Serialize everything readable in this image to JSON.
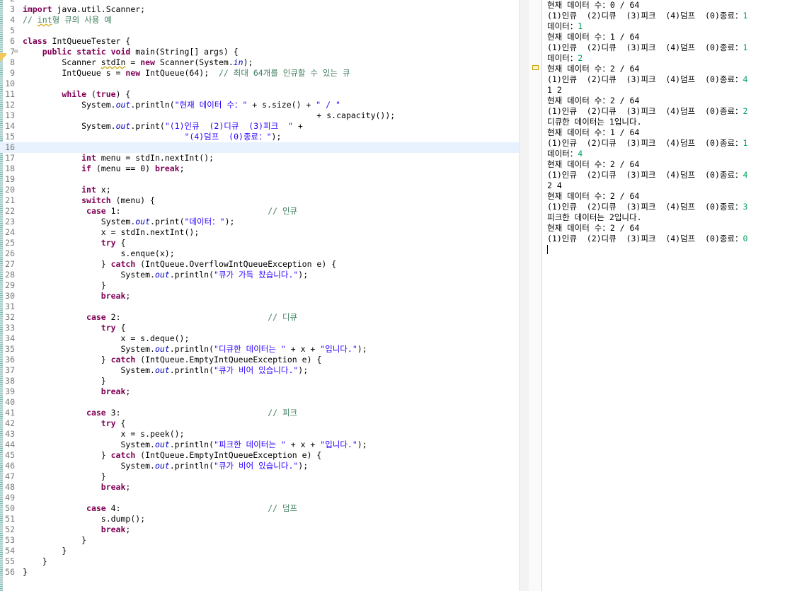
{
  "editor": {
    "lines": [
      {
        "n": "2",
        "t": []
      },
      {
        "n": "3",
        "t": [
          {
            "k": "kw",
            "v": "import"
          },
          {
            "k": "",
            "v": " java.util.Scanner;"
          }
        ]
      },
      {
        "n": "4",
        "t": [
          {
            "k": "cm",
            "v": "// "
          },
          {
            "k": "cm sq",
            "v": "int"
          },
          {
            "k": "cm",
            "v": "형 큐의 사용 예"
          }
        ]
      },
      {
        "n": "5",
        "t": []
      },
      {
        "n": "6",
        "t": [
          {
            "k": "kw",
            "v": "class"
          },
          {
            "k": "",
            "v": " IntQueueTester {"
          }
        ]
      },
      {
        "n": "7",
        "fold": "⊖",
        "t": [
          {
            "k": "",
            "v": "    "
          },
          {
            "k": "kw",
            "v": "public static void"
          },
          {
            "k": "",
            "v": " main(String[] args) {"
          }
        ]
      },
      {
        "n": "8",
        "t": [
          {
            "k": "",
            "v": "        Scanner "
          },
          {
            "k": "sq",
            "v": "stdIn"
          },
          {
            "k": "",
            "v": " = "
          },
          {
            "k": "kw",
            "v": "new"
          },
          {
            "k": "",
            "v": " Scanner(System."
          },
          {
            "k": "fld",
            "v": "in"
          },
          {
            "k": "",
            "v": ");"
          }
        ]
      },
      {
        "n": "9",
        "t": [
          {
            "k": "",
            "v": "        IntQueue s = "
          },
          {
            "k": "kw",
            "v": "new"
          },
          {
            "k": "",
            "v": " IntQueue(64);  "
          },
          {
            "k": "cm",
            "v": "// 최대 64개를 인큐할 수 있는 큐"
          }
        ]
      },
      {
        "n": "10",
        "t": []
      },
      {
        "n": "11",
        "t": [
          {
            "k": "",
            "v": "        "
          },
          {
            "k": "kw",
            "v": "while"
          },
          {
            "k": "",
            "v": " ("
          },
          {
            "k": "kw",
            "v": "true"
          },
          {
            "k": "",
            "v": ") {"
          }
        ]
      },
      {
        "n": "12",
        "t": [
          {
            "k": "",
            "v": "            System."
          },
          {
            "k": "fld",
            "v": "out"
          },
          {
            "k": "",
            "v": ".println("
          },
          {
            "k": "str",
            "v": "\"현재 데이터 수：\""
          },
          {
            "k": "",
            "v": " + s.size() + "
          },
          {
            "k": "str",
            "v": "\" / \""
          }
        ]
      },
      {
        "n": "13",
        "t": [
          {
            "k": "",
            "v": "                                                            + s.capacity());"
          }
        ]
      },
      {
        "n": "14",
        "t": [
          {
            "k": "",
            "v": "            System."
          },
          {
            "k": "fld",
            "v": "out"
          },
          {
            "k": "",
            "v": ".print("
          },
          {
            "k": "str",
            "v": "\"(1)인큐  (2)디큐  (3)피크  \""
          },
          {
            "k": "",
            "v": " +"
          }
        ]
      },
      {
        "n": "15",
        "t": [
          {
            "k": "",
            "v": "                                 "
          },
          {
            "k": "str",
            "v": "\"(4)덤프  (0)종료：\""
          },
          {
            "k": "",
            "v": ");"
          }
        ]
      },
      {
        "n": "16",
        "current": true,
        "t": []
      },
      {
        "n": "17",
        "t": [
          {
            "k": "",
            "v": "            "
          },
          {
            "k": "kw",
            "v": "int"
          },
          {
            "k": "",
            "v": " menu = stdIn.nextInt();"
          }
        ]
      },
      {
        "n": "18",
        "t": [
          {
            "k": "",
            "v": "            "
          },
          {
            "k": "kw",
            "v": "if"
          },
          {
            "k": "",
            "v": " (menu == 0) "
          },
          {
            "k": "kw",
            "v": "break"
          },
          {
            "k": "",
            "v": ";"
          }
        ]
      },
      {
        "n": "19",
        "t": []
      },
      {
        "n": "20",
        "t": [
          {
            "k": "",
            "v": "            "
          },
          {
            "k": "kw",
            "v": "int"
          },
          {
            "k": "",
            "v": " x;"
          }
        ]
      },
      {
        "n": "21",
        "t": [
          {
            "k": "",
            "v": "            "
          },
          {
            "k": "kw",
            "v": "switch"
          },
          {
            "k": "",
            "v": " (menu) {"
          }
        ]
      },
      {
        "n": "22",
        "t": [
          {
            "k": "",
            "v": "             "
          },
          {
            "k": "kw",
            "v": "case"
          },
          {
            "k": "",
            "v": " 1:                              "
          },
          {
            "k": "cm",
            "v": "// 인큐"
          }
        ]
      },
      {
        "n": "23",
        "t": [
          {
            "k": "",
            "v": "                System."
          },
          {
            "k": "fld",
            "v": "out"
          },
          {
            "k": "",
            "v": ".print("
          },
          {
            "k": "str",
            "v": "\"데이터：\""
          },
          {
            "k": "",
            "v": ");"
          }
        ]
      },
      {
        "n": "24",
        "t": [
          {
            "k": "",
            "v": "                x = stdIn.nextInt();"
          }
        ]
      },
      {
        "n": "25",
        "t": [
          {
            "k": "",
            "v": "                "
          },
          {
            "k": "kw",
            "v": "try"
          },
          {
            "k": "",
            "v": " {"
          }
        ]
      },
      {
        "n": "26",
        "t": [
          {
            "k": "",
            "v": "                    s.enque(x);"
          }
        ]
      },
      {
        "n": "27",
        "t": [
          {
            "k": "",
            "v": "                } "
          },
          {
            "k": "kw",
            "v": "catch"
          },
          {
            "k": "",
            "v": " (IntQueue.OverflowIntQueueException e) {"
          }
        ]
      },
      {
        "n": "28",
        "t": [
          {
            "k": "",
            "v": "                    System."
          },
          {
            "k": "fld",
            "v": "out"
          },
          {
            "k": "",
            "v": ".println("
          },
          {
            "k": "str",
            "v": "\"큐가 가득 찼습니다.\""
          },
          {
            "k": "",
            "v": ");"
          }
        ]
      },
      {
        "n": "29",
        "t": [
          {
            "k": "",
            "v": "                }"
          }
        ]
      },
      {
        "n": "30",
        "t": [
          {
            "k": "",
            "v": "                "
          },
          {
            "k": "kw",
            "v": "break"
          },
          {
            "k": "",
            "v": ";"
          }
        ]
      },
      {
        "n": "31",
        "t": []
      },
      {
        "n": "32",
        "t": [
          {
            "k": "",
            "v": "             "
          },
          {
            "k": "kw",
            "v": "case"
          },
          {
            "k": "",
            "v": " 2:                              "
          },
          {
            "k": "cm",
            "v": "// 디큐"
          }
        ]
      },
      {
        "n": "33",
        "t": [
          {
            "k": "",
            "v": "                "
          },
          {
            "k": "kw",
            "v": "try"
          },
          {
            "k": "",
            "v": " {"
          }
        ]
      },
      {
        "n": "34",
        "t": [
          {
            "k": "",
            "v": "                    x = s.deque();"
          }
        ]
      },
      {
        "n": "35",
        "t": [
          {
            "k": "",
            "v": "                    System."
          },
          {
            "k": "fld",
            "v": "out"
          },
          {
            "k": "",
            "v": ".println("
          },
          {
            "k": "str",
            "v": "\"디큐한 데이터는 \""
          },
          {
            "k": "",
            "v": " + x + "
          },
          {
            "k": "str",
            "v": "\"입니다.\""
          },
          {
            "k": "",
            "v": ");"
          }
        ]
      },
      {
        "n": "36",
        "t": [
          {
            "k": "",
            "v": "                } "
          },
          {
            "k": "kw",
            "v": "catch"
          },
          {
            "k": "",
            "v": " (IntQueue.EmptyIntQueueException e) {"
          }
        ]
      },
      {
        "n": "37",
        "t": [
          {
            "k": "",
            "v": "                    System."
          },
          {
            "k": "fld",
            "v": "out"
          },
          {
            "k": "",
            "v": ".println("
          },
          {
            "k": "str",
            "v": "\"큐가 비어 있습니다.\""
          },
          {
            "k": "",
            "v": ");"
          }
        ]
      },
      {
        "n": "38",
        "t": [
          {
            "k": "",
            "v": "                }"
          }
        ]
      },
      {
        "n": "39",
        "t": [
          {
            "k": "",
            "v": "                "
          },
          {
            "k": "kw",
            "v": "break"
          },
          {
            "k": "",
            "v": ";"
          }
        ]
      },
      {
        "n": "40",
        "t": []
      },
      {
        "n": "41",
        "t": [
          {
            "k": "",
            "v": "             "
          },
          {
            "k": "kw",
            "v": "case"
          },
          {
            "k": "",
            "v": " 3:                              "
          },
          {
            "k": "cm",
            "v": "// 피크"
          }
        ]
      },
      {
        "n": "42",
        "t": [
          {
            "k": "",
            "v": "                "
          },
          {
            "k": "kw",
            "v": "try"
          },
          {
            "k": "",
            "v": " {"
          }
        ]
      },
      {
        "n": "43",
        "t": [
          {
            "k": "",
            "v": "                    x = s.peek();"
          }
        ]
      },
      {
        "n": "44",
        "t": [
          {
            "k": "",
            "v": "                    System."
          },
          {
            "k": "fld",
            "v": "out"
          },
          {
            "k": "",
            "v": ".println("
          },
          {
            "k": "str",
            "v": "\"피크한 데이터는 \""
          },
          {
            "k": "",
            "v": " + x + "
          },
          {
            "k": "str",
            "v": "\"입니다.\""
          },
          {
            "k": "",
            "v": ");"
          }
        ]
      },
      {
        "n": "45",
        "t": [
          {
            "k": "",
            "v": "                } "
          },
          {
            "k": "kw",
            "v": "catch"
          },
          {
            "k": "",
            "v": " (IntQueue.EmptyIntQueueException e) {"
          }
        ]
      },
      {
        "n": "46",
        "t": [
          {
            "k": "",
            "v": "                    System."
          },
          {
            "k": "fld",
            "v": "out"
          },
          {
            "k": "",
            "v": ".println("
          },
          {
            "k": "str",
            "v": "\"큐가 비어 있습니다.\""
          },
          {
            "k": "",
            "v": ");"
          }
        ]
      },
      {
        "n": "47",
        "t": [
          {
            "k": "",
            "v": "                }"
          }
        ]
      },
      {
        "n": "48",
        "t": [
          {
            "k": "",
            "v": "                "
          },
          {
            "k": "kw",
            "v": "break"
          },
          {
            "k": "",
            "v": ";"
          }
        ]
      },
      {
        "n": "49",
        "t": []
      },
      {
        "n": "50",
        "t": [
          {
            "k": "",
            "v": "             "
          },
          {
            "k": "kw",
            "v": "case"
          },
          {
            "k": "",
            "v": " 4:                              "
          },
          {
            "k": "cm",
            "v": "// 덤프"
          }
        ]
      },
      {
        "n": "51",
        "t": [
          {
            "k": "",
            "v": "                s.dump();"
          }
        ]
      },
      {
        "n": "52",
        "t": [
          {
            "k": "",
            "v": "                "
          },
          {
            "k": "kw",
            "v": "break"
          },
          {
            "k": "",
            "v": ";"
          }
        ]
      },
      {
        "n": "53",
        "t": [
          {
            "k": "",
            "v": "            }"
          }
        ]
      },
      {
        "n": "54",
        "t": [
          {
            "k": "",
            "v": "        }"
          }
        ]
      },
      {
        "n": "55",
        "t": [
          {
            "k": "",
            "v": "    }"
          }
        ]
      },
      {
        "n": "56",
        "t": [
          {
            "k": "",
            "v": "}"
          }
        ]
      }
    ]
  },
  "console": {
    "lines": [
      {
        "text": "현재 데이터 수：0 / 64"
      },
      {
        "text": "(1)인큐  (2)디큐  (3)피크  (4)덤프  (0)종료：",
        "input": "1"
      },
      {
        "text": "데이터：",
        "input": "1"
      },
      {
        "text": "현재 데이터 수：1 / 64"
      },
      {
        "text": "(1)인큐  (2)디큐  (3)피크  (4)덤프  (0)종료：",
        "input": "1"
      },
      {
        "text": "데이터：",
        "input": "2"
      },
      {
        "text": "현재 데이터 수：2 / 64"
      },
      {
        "text": "(1)인큐  (2)디큐  (3)피크  (4)덤프  (0)종료：",
        "input": "4"
      },
      {
        "text": "1 2"
      },
      {
        "text": "현재 데이터 수：2 / 64"
      },
      {
        "text": "(1)인큐  (2)디큐  (3)피크  (4)덤프  (0)종료：",
        "input": "2"
      },
      {
        "text": "디큐한 데이터는 1입니다."
      },
      {
        "text": "현재 데이터 수：1 / 64"
      },
      {
        "text": "(1)인큐  (2)디큐  (3)피크  (4)덤프  (0)종료：",
        "input": "1"
      },
      {
        "text": "데이터：",
        "input": "4"
      },
      {
        "text": "현재 데이터 수：2 / 64"
      },
      {
        "text": "(1)인큐  (2)디큐  (3)피크  (4)덤프  (0)종료：",
        "input": "4"
      },
      {
        "text": "2 4"
      },
      {
        "text": "현재 데이터 수：2 / 64"
      },
      {
        "text": "(1)인큐  (2)디큐  (3)피크  (4)덤프  (0)종료：",
        "input": "3"
      },
      {
        "text": "피크한 데이터는 2입니다."
      },
      {
        "text": "현재 데이터 수：2 / 64"
      },
      {
        "text": "(1)인큐  (2)디큐  (3)피크  (4)덤프  (0)종료：",
        "input": "0"
      }
    ]
  },
  "colors": {
    "keyword": "#7f0055",
    "string": "#2a00ff",
    "comment": "#3f7f5f",
    "field": "#0000c0",
    "console_input": "#00a35a",
    "current_line": "#e8f2fe"
  }
}
